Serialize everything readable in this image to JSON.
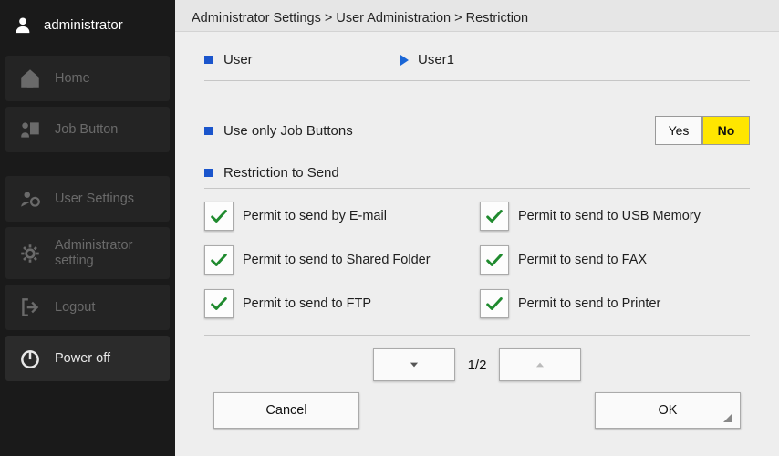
{
  "sidebar": {
    "user": "administrator",
    "items": [
      {
        "label": "Home"
      },
      {
        "label": "Job Button"
      },
      {
        "label": "User Settings"
      },
      {
        "label": "Administrator setting"
      },
      {
        "label": "Logout"
      },
      {
        "label": "Power off"
      }
    ]
  },
  "breadcrumb": "Administrator Settings > User Administration > Restriction",
  "user_row": {
    "label": "User",
    "value": "User1"
  },
  "jobbtn_row": {
    "label": "Use only Job Buttons",
    "yes": "Yes",
    "no": "No",
    "selected": "No"
  },
  "restrict_header": "Restriction to Send",
  "permits": [
    {
      "label": "Permit to send by E-mail"
    },
    {
      "label": "Permit to send to USB Memory"
    },
    {
      "label": "Permit to send to Shared Folder"
    },
    {
      "label": "Permit to send to FAX"
    },
    {
      "label": "Permit to send to FTP"
    },
    {
      "label": "Permit to send to Printer"
    }
  ],
  "pager": {
    "index": "1/2"
  },
  "footer": {
    "cancel": "Cancel",
    "ok": "OK"
  }
}
